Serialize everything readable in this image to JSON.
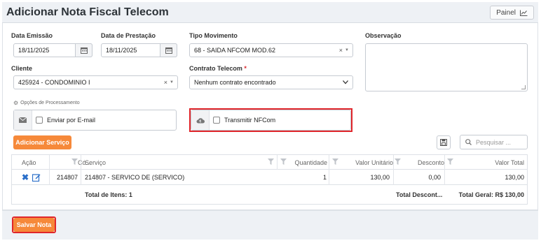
{
  "header": {
    "title": "Adicionar Nota Fiscal Telecom",
    "painel_label": "Painel"
  },
  "form": {
    "data_emissao": {
      "label": "Data Emissão",
      "value": "18/11/2025"
    },
    "data_prestacao": {
      "label": "Data de Prestação",
      "value": "18/11/2025"
    },
    "tipo_movimento": {
      "label": "Tipo Movimento",
      "value": "68 - SAIDA NFCOM MOD.62"
    },
    "observacao": {
      "label": "Observação",
      "value": ""
    },
    "cliente": {
      "label": "Cliente",
      "value": "425924 - CONDOMINIO I"
    },
    "contrato": {
      "label": "Contrato Telecom",
      "required_mark": "*",
      "value": "Nenhum contrato encontrado"
    }
  },
  "options": {
    "title": "Opções de Processamento",
    "enviar_email": {
      "label": "Enviar por E-mail",
      "checked": false
    },
    "transmitir": {
      "label": "Transmitir NFCom",
      "checked": false
    }
  },
  "toolbar": {
    "add_service_label": "Adicionar Serviço",
    "search_placeholder": "Pesquisar ..."
  },
  "grid": {
    "columns": [
      "Ação",
      "Có...",
      "Serviço",
      "Quantidade",
      "Valor Unitário",
      "Desconto",
      "Valor Total"
    ],
    "rows": [
      {
        "codigo": "214807",
        "servico": "214807 - SERVICO DE (SERVICO)",
        "quantidade": "1",
        "valor_unitario": "130,00",
        "desconto": "0,00",
        "valor_total": "130,00"
      }
    ],
    "footer": {
      "total_itens": "Total de Itens: 1",
      "total_desconto": "Total Descont...",
      "total_geral": "Total Geral: R$ 130,00"
    }
  },
  "footer": {
    "save_label": "Salvar Nota"
  },
  "colors": {
    "accent": "#f6893a",
    "highlight": "#e0262b",
    "link_icon": "#2a6fc9"
  }
}
